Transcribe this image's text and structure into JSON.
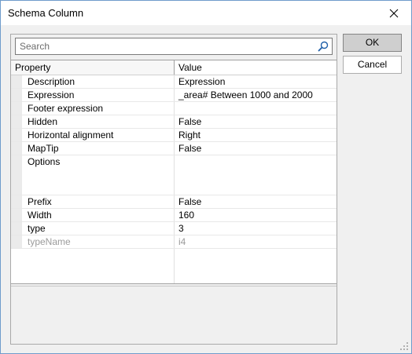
{
  "window": {
    "title": "Schema Column"
  },
  "search": {
    "placeholder": "Search",
    "value": ""
  },
  "grid": {
    "columns": [
      "Property",
      "Value"
    ],
    "rows": [
      {
        "property": "Description",
        "value": "Expression"
      },
      {
        "property": "Expression",
        "value": "_area# Between 1000 and 2000"
      },
      {
        "property": "Footer expression",
        "value": ""
      },
      {
        "property": "Hidden",
        "value": "False"
      },
      {
        "property": "Horizontal alignment",
        "value": "Right"
      },
      {
        "property": "MapTip",
        "value": "False"
      },
      {
        "property": "Options",
        "value": ""
      },
      {
        "property": "Prefix",
        "value": "False"
      },
      {
        "property": "Width",
        "value": "160"
      },
      {
        "property": "type",
        "value": "3"
      },
      {
        "property": "typeName",
        "value": "i4"
      }
    ]
  },
  "buttons": {
    "ok": "OK",
    "cancel": "Cancel"
  },
  "icons": {
    "close": "close-icon",
    "search": "search-icon",
    "resize": "resize-grip-icon"
  },
  "colors": {
    "window_border": "#6f9ccb",
    "readonly_text": "#9b9b9b"
  }
}
